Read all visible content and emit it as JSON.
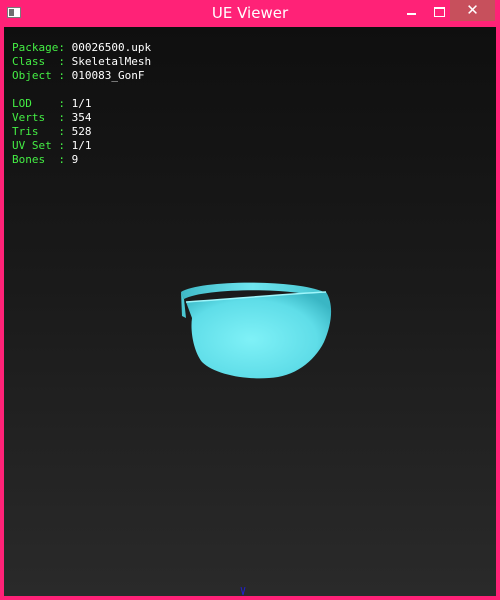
{
  "window": {
    "title": "UE Viewer",
    "controls": {
      "minimize": "minimize-button",
      "maximize": "maximize-button",
      "close": "✕"
    },
    "frame_color": "#ff2277",
    "close_color": "#c7505c"
  },
  "info": {
    "package": {
      "key": "Package",
      "value": "00026500.upk"
    },
    "class": {
      "key": "Class  ",
      "value": "SkeletalMesh"
    },
    "object": {
      "key": "Object ",
      "value": "010083_GonF"
    },
    "lod": {
      "key": "LOD    ",
      "value": "1/1"
    },
    "verts": {
      "key": "Verts  ",
      "value": "354"
    },
    "tris": {
      "key": "Tris   ",
      "value": "528"
    },
    "uvset": {
      "key": "UV Set ",
      "value": "1/1"
    },
    "bones": {
      "key": "Bones  ",
      "value": "9"
    }
  },
  "colors": {
    "key_text": "#44ee44",
    "value_text": "#ffffff",
    "mesh": "#6fe6f0"
  },
  "icons": {
    "app": "app-window-icon",
    "axis": "axis-indicator-icon"
  }
}
